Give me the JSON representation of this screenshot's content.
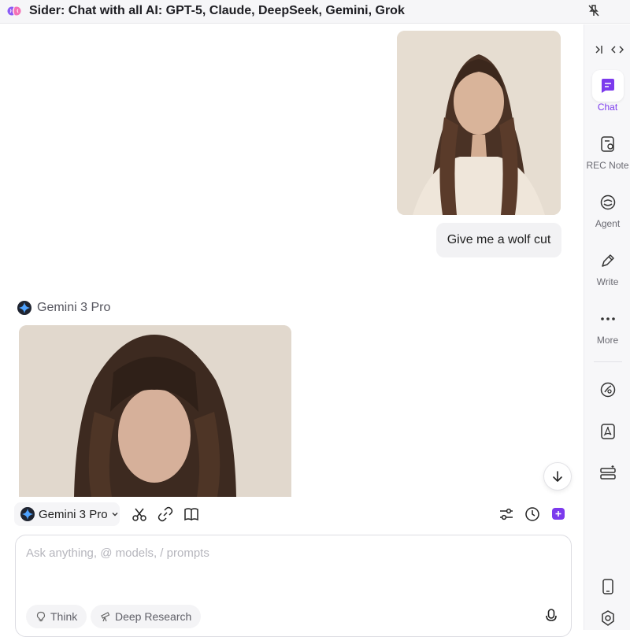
{
  "window": {
    "title": "Sider: Chat with all AI: GPT-5, Claude, DeepSeek, Gemini, Grok"
  },
  "chat": {
    "user_message": "Give me a wolf cut",
    "ai_model_name": "Gemini 3 Pro"
  },
  "toolbar": {
    "model_label": "Gemini 3 Pro",
    "icons": [
      "scissors-icon",
      "link-icon",
      "book-icon",
      "sliders-icon",
      "history-icon",
      "new-chat-icon"
    ]
  },
  "composer": {
    "placeholder": "Ask anything, @ models, / prompts",
    "value": "",
    "think_label": "Think",
    "deep_research_label": "Deep Research"
  },
  "sidebar": {
    "items": [
      {
        "label": "Chat",
        "icon": "chat-icon",
        "active": true
      },
      {
        "label": "REC Note",
        "icon": "rec-note-icon",
        "active": false
      },
      {
        "label": "Agent",
        "icon": "agent-icon",
        "active": false
      },
      {
        "label": "Write",
        "icon": "write-icon",
        "active": false
      },
      {
        "label": "More",
        "icon": "more-icon",
        "active": false
      }
    ]
  },
  "colors": {
    "accent": "#7c3aed",
    "bubble": "#f2f2f4",
    "sidebar_bg": "#f7f7f9"
  }
}
